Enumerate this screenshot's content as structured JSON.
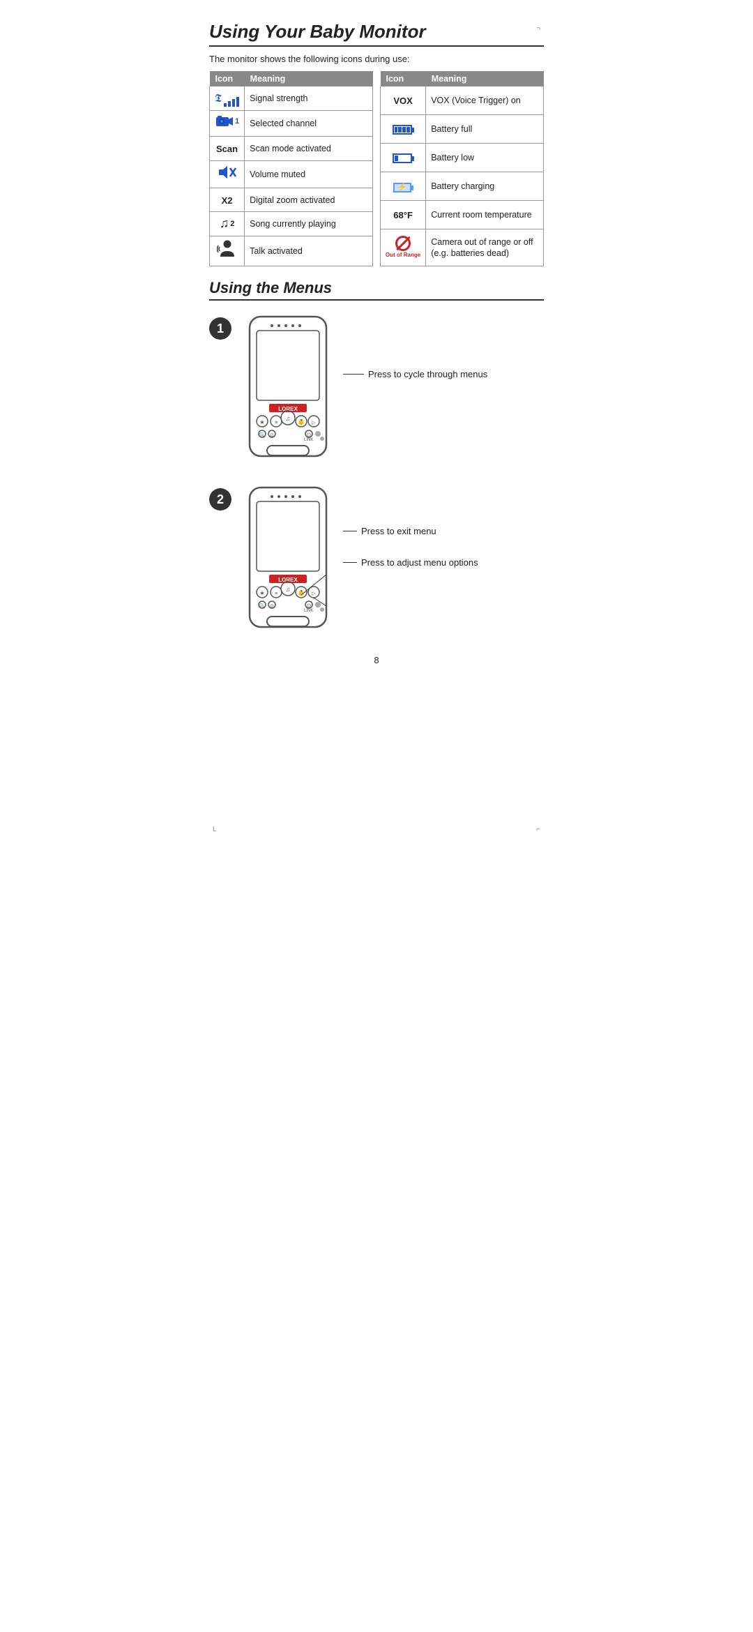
{
  "page": {
    "title": "Using Your Baby Monitor",
    "subtitle": "Using the Menus",
    "intro": "The monitor shows the following icons during use:",
    "page_number": "8"
  },
  "table_left": {
    "header_icon": "Icon",
    "header_meaning": "Meaning",
    "rows": [
      {
        "icon_name": "signal-strength-icon",
        "meaning": "Signal strength"
      },
      {
        "icon_name": "selected-channel-icon",
        "meaning": "Selected channel"
      },
      {
        "icon_name": "scan-mode-icon",
        "meaning": "Scan mode activated"
      },
      {
        "icon_name": "volume-muted-icon",
        "meaning": "Volume muted"
      },
      {
        "icon_name": "digital-zoom-icon",
        "meaning": "Digital zoom activated"
      },
      {
        "icon_name": "song-playing-icon",
        "meaning": "Song currently playing"
      },
      {
        "icon_name": "talk-activated-icon",
        "meaning": "Talk activated"
      }
    ]
  },
  "table_right": {
    "header_icon": "Icon",
    "header_meaning": "Meaning",
    "rows": [
      {
        "icon_name": "vox-icon",
        "meaning": "VOX (Voice Trigger) on"
      },
      {
        "icon_name": "battery-full-icon",
        "meaning": "Battery full"
      },
      {
        "icon_name": "battery-low-icon",
        "meaning": "Battery low"
      },
      {
        "icon_name": "battery-charging-icon",
        "meaning": "Battery charging"
      },
      {
        "icon_name": "temp-icon",
        "meaning": "Current room temperature"
      },
      {
        "icon_name": "out-of-range-icon",
        "meaning": "Camera out of range or off (e.g. batteries dead)"
      }
    ]
  },
  "device1": {
    "step": "1",
    "label": "Press to cycle through menus"
  },
  "device2": {
    "step": "2",
    "label1": "Press to exit menu",
    "label2": "Press to adjust menu options"
  },
  "icons": {
    "scan_label": "Scan",
    "x2_label": "X2",
    "vox_label": "VOX",
    "temp_label": "68°F",
    "music_num": "2"
  }
}
